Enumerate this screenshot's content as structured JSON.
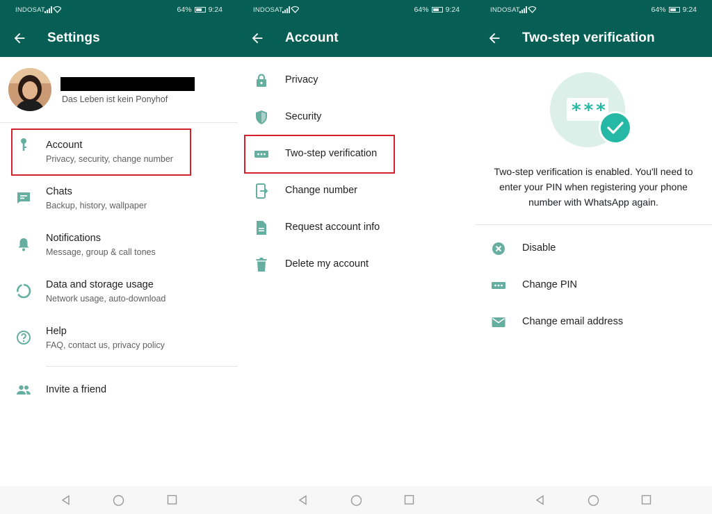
{
  "status_bar": {
    "carrier": "INDOSAT",
    "battery": "64%",
    "time": "9:24"
  },
  "colors": {
    "primary": "#075e54",
    "icon": "#65aea0",
    "accent": "#25b8a5",
    "highlight": "#d4202a"
  },
  "settings": {
    "title": "Settings",
    "profile_status": "Das Leben ist kein Ponyhof",
    "items": [
      {
        "label": "Account",
        "sub": "Privacy, security, change number",
        "icon": "key-icon"
      },
      {
        "label": "Chats",
        "sub": "Backup, history, wallpaper",
        "icon": "chat-icon"
      },
      {
        "label": "Notifications",
        "sub": "Message, group & call tones",
        "icon": "bell-icon"
      },
      {
        "label": "Data and storage usage",
        "sub": "Network usage, auto-download",
        "icon": "data-usage-icon"
      },
      {
        "label": "Help",
        "sub": "FAQ, contact us, privacy policy",
        "icon": "help-icon"
      }
    ],
    "invite": {
      "label": "Invite a friend",
      "icon": "people-icon"
    }
  },
  "account": {
    "title": "Account",
    "items": [
      {
        "label": "Privacy",
        "icon": "lock-icon"
      },
      {
        "label": "Security",
        "icon": "shield-icon"
      },
      {
        "label": "Two-step verification",
        "icon": "dots-icon"
      },
      {
        "label": "Change number",
        "icon": "phone-change-icon"
      },
      {
        "label": "Request account info",
        "icon": "document-icon"
      },
      {
        "label": "Delete my account",
        "icon": "trash-icon"
      }
    ]
  },
  "two_step": {
    "title": "Two-step verification",
    "pin_mask": "***",
    "description": "Two-step verification is enabled. You'll need to enter your PIN when registering your phone number with WhatsApp again.",
    "items": [
      {
        "label": "Disable",
        "icon": "cancel-icon"
      },
      {
        "label": "Change PIN",
        "icon": "dots-icon"
      },
      {
        "label": "Change email address",
        "icon": "mail-icon"
      }
    ]
  }
}
